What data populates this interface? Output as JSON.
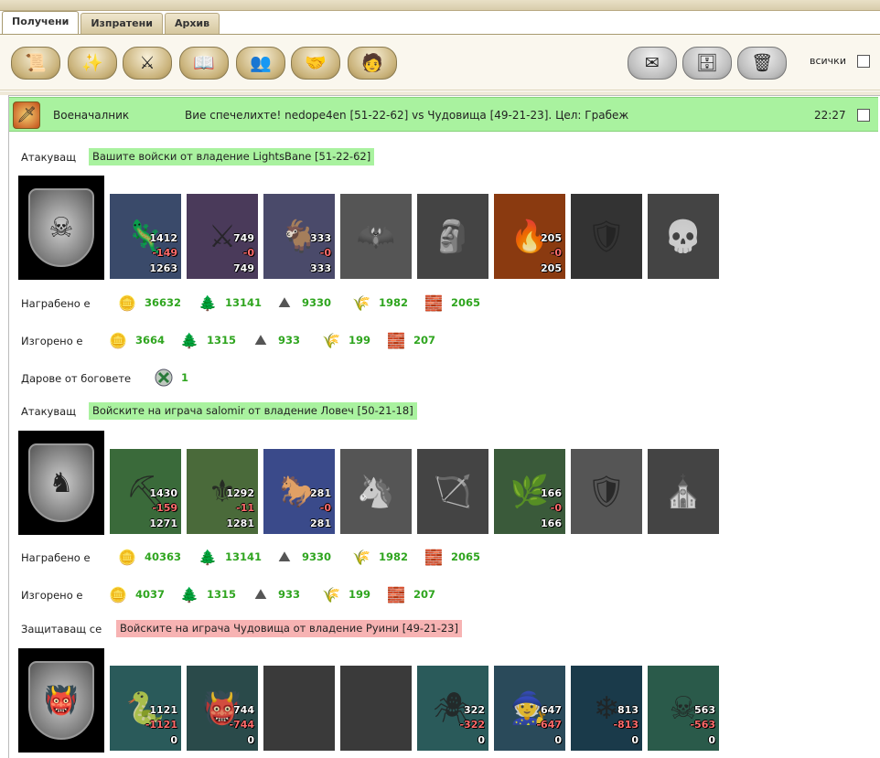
{
  "tabs": [
    {
      "label": "Получени",
      "active": true
    },
    {
      "label": "Изпратени",
      "active": false
    },
    {
      "label": "Архив",
      "active": false
    }
  ],
  "toolbar": {
    "left_icons": [
      "scroll-icon",
      "magic-icon",
      "sword-icon",
      "book-icon",
      "people-icon",
      "handshake-icon",
      "hero-icon"
    ],
    "right_icons": [
      "envelope-icon",
      "archive-icon",
      "trash-icon"
    ],
    "all_label": "всички"
  },
  "message": {
    "type": "Военачалник",
    "subject": "Вие спечелихте! nedope4en [51-22-62] vs Чудовища [49-21-23]. Цел: Грабеж",
    "time": "22:27",
    "icon": "battle-sword-icon",
    "highlight_color": "#a9f29f"
  },
  "resource_icons": [
    "gold-icon",
    "wood-icon",
    "ore-icon",
    "wheat-icon",
    "stone-icon"
  ],
  "sections": [
    {
      "role": "Атакуващ",
      "title": "Вашите войски от владение LightsBane [51-22-62]",
      "banner_color": "#a9f29f",
      "emblem": "demon-emblem",
      "units": [
        {
          "icon": "lizard-icon",
          "n1": "1412",
          "n2": "-149",
          "n3": "1263",
          "gray": false,
          "bg": "#3a4a6a"
        },
        {
          "icon": "warrior-icon",
          "n1": "749",
          "n2": "-0",
          "n3": "749",
          "gray": false,
          "bg": "#4a3a5a"
        },
        {
          "icon": "beast-icon",
          "n1": "333",
          "n2": "-0",
          "n3": "333",
          "gray": false,
          "bg": "#4a4a6a"
        },
        {
          "icon": "gargoyle-icon",
          "n1": "",
          "n2": "",
          "n3": "",
          "gray": true,
          "bg": "#555"
        },
        {
          "icon": "golem-icon",
          "n1": "",
          "n2": "",
          "n3": "",
          "gray": true,
          "bg": "#444"
        },
        {
          "icon": "fire-mage-icon",
          "n1": "205",
          "n2": "-0",
          "n3": "205",
          "gray": false,
          "bg": "#8a3a10"
        },
        {
          "icon": "knight-icon",
          "n1": "",
          "n2": "",
          "n3": "",
          "gray": true,
          "bg": "#333"
        },
        {
          "icon": "reaper-icon",
          "n1": "",
          "n2": "",
          "n3": "",
          "gray": true,
          "bg": "#444"
        }
      ],
      "looted_label": "Награбено е",
      "looted": [
        "36632",
        "13141",
        "9330",
        "1982",
        "2065"
      ],
      "burned_label": "Изгорено е",
      "burned": [
        "3664",
        "1315",
        "933",
        "199",
        "207"
      ],
      "gifts_label": "Дарове от боговете",
      "gifts_icon": "gift-orb-icon",
      "gifts_value": "1"
    },
    {
      "role": "Атакуващ",
      "title": "Войските на играча salomir от владение Ловеч [50-21-18]",
      "banner_color": "#a9f29f",
      "emblem": "lion-shield-emblem",
      "units": [
        {
          "icon": "dwarf-icon",
          "n1": "1430",
          "n2": "-159",
          "n3": "1271",
          "gray": false,
          "bg": "#3a6a3a"
        },
        {
          "icon": "paladin-icon",
          "n1": "1292",
          "n2": "-11",
          "n3": "1281",
          "gray": false,
          "bg": "#4a6a3a"
        },
        {
          "icon": "cavalry-icon",
          "n1": "281",
          "n2": "-0",
          "n3": "281",
          "gray": false,
          "bg": "#3a4a8a"
        },
        {
          "icon": "pegasus-icon",
          "n1": "",
          "n2": "",
          "n3": "",
          "gray": true,
          "bg": "#555"
        },
        {
          "icon": "archer-icon",
          "n1": "",
          "n2": "",
          "n3": "",
          "gray": true,
          "bg": "#444"
        },
        {
          "icon": "druid-icon",
          "n1": "166",
          "n2": "-0",
          "n3": "166",
          "gray": false,
          "bg": "#3a5a3a"
        },
        {
          "icon": "guard-icon",
          "n1": "",
          "n2": "",
          "n3": "",
          "gray": true,
          "bg": "#555"
        },
        {
          "icon": "monk-icon",
          "n1": "",
          "n2": "",
          "n3": "",
          "gray": true,
          "bg": "#444"
        }
      ],
      "looted_label": "Награбено е",
      "looted": [
        "40363",
        "13141",
        "9330",
        "1982",
        "2065"
      ],
      "burned_label": "Изгорено е",
      "burned": [
        "4037",
        "1315",
        "933",
        "199",
        "207"
      ]
    },
    {
      "role": "Защитаващ се",
      "title": "Войските на играча Чудовища от владение Руини [49-21-23]",
      "banner_color": "#f7b3b3",
      "emblem": "monster-emblem",
      "units": [
        {
          "icon": "snake-icon",
          "n1": "1121",
          "n2": "-1121",
          "n3": "0",
          "gray": false,
          "bg": "#2a5a5a"
        },
        {
          "icon": "troll-icon",
          "n1": "744",
          "n2": "-744",
          "n3": "0",
          "gray": false,
          "bg": "#2a4a4a"
        },
        {
          "icon": "empty-slot-icon",
          "n1": "",
          "n2": "",
          "n3": "",
          "gray": true,
          "bg": "#3a3a3a"
        },
        {
          "icon": "empty-slot-icon",
          "n1": "",
          "n2": "",
          "n3": "",
          "gray": true,
          "bg": "#3a3a3a"
        },
        {
          "icon": "spider-icon",
          "n1": "322",
          "n2": "-322",
          "n3": "0",
          "gray": false,
          "bg": "#2a5a5a"
        },
        {
          "icon": "hag-icon",
          "n1": "647",
          "n2": "-647",
          "n3": "0",
          "gray": false,
          "bg": "#2a4a5a"
        },
        {
          "icon": "ice-elemental-icon",
          "n1": "813",
          "n2": "-813",
          "n3": "0",
          "gray": false,
          "bg": "#1a3a4a"
        },
        {
          "icon": "lich-icon",
          "n1": "563",
          "n2": "-563",
          "n3": "0",
          "gray": false,
          "bg": "#2a5a4a"
        }
      ]
    }
  ]
}
